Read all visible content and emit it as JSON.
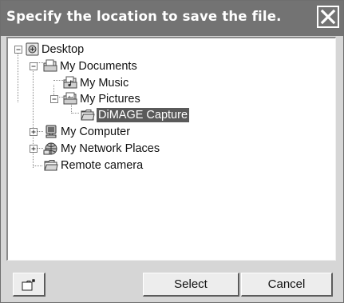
{
  "title": "Specify the location to save the file.",
  "tree": [
    {
      "label": "Desktop",
      "icon": "desktop-icon",
      "expander": "minus"
    },
    {
      "label": "My Documents",
      "icon": "documents-folder-icon",
      "expander": "minus"
    },
    {
      "label": "My Music",
      "icon": "music-folder-icon",
      "expander": ""
    },
    {
      "label": "My Pictures",
      "icon": "pictures-folder-icon",
      "expander": "minus"
    },
    {
      "label": "DiMAGE Capture",
      "icon": "folder-icon",
      "expander": "",
      "selected": true
    },
    {
      "label": "My Computer",
      "icon": "computer-icon",
      "expander": "plus"
    },
    {
      "label": "My Network Places",
      "icon": "network-icon",
      "expander": "plus"
    },
    {
      "label": "Remote camera",
      "icon": "folder-icon",
      "expander": ""
    }
  ],
  "buttons": {
    "new_folder_icon": "new-folder-icon",
    "select": "Select",
    "cancel": "Cancel"
  },
  "colors": {
    "titlebar": "#737373",
    "selection": "#5a5a5a"
  }
}
